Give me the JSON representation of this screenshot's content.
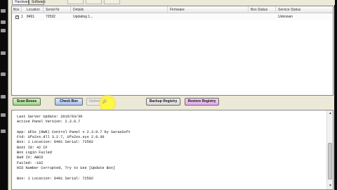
{
  "tabs": [
    "Hardware",
    "Software"
  ],
  "grid": {
    "columns": [
      "Box",
      "Location",
      "Serial Nr",
      "Details",
      "Firmware",
      "Box Status",
      "Service Status"
    ],
    "rows": [
      {
        "checked": true,
        "box": "1",
        "location": "8491",
        "serial": "72592",
        "details": "Updating 1...",
        "firmware": "",
        "box_status": "",
        "service_status": "Unknown"
      }
    ]
  },
  "buttons": {
    "scan": "Scan Boxes",
    "check": "Check Box",
    "update": "Update Box",
    "backup": "Backup Registry",
    "restore": "Restore Registry"
  },
  "log_lines": [
    "Last Server Update: 2016/03/30",
    "Active Panel Version: 2.3.0.7",
    "",
    "App: UFSx (HWK) Control Panel v 2.3.0.7 by SarasSoft",
    "Ftd: Ufs2xx.dll 3.2.7, Ufs2xx.sys 2.8.30",
    "Box: 1 Location: 8491 Serial: 72592",
    "Boot Id: 42 CF",
    "Box Login Failed",
    "Bad IX: ABCD",
    "Failed: -102",
    "HID Number Corrupted, Try to Use [Update Box]",
    "",
    "Box: 1 Location: 8491 Serial: 72592"
  ],
  "colors": {
    "window_bg": "#ece9d8",
    "scan_button": "#9fd78a",
    "check_button": "#a9c1ee",
    "restore_button": "#e4a8e8",
    "cursor_highlight": "#fff23c"
  },
  "icons": [
    "checkbox-checked-icon",
    "mouse-pointer-icon",
    "scroll-up-arrow-icon",
    "scroll-down-arrow-icon"
  ]
}
